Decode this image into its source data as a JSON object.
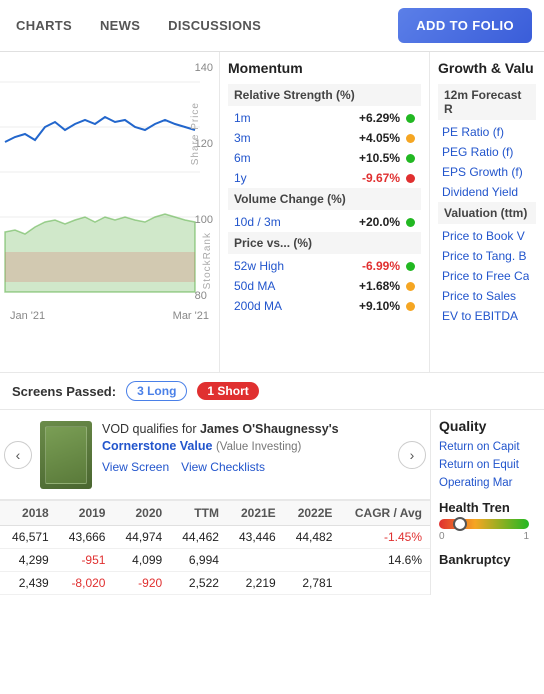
{
  "nav": {
    "items": [
      "CHARTS",
      "NEWS",
      "DISCUSSIONS"
    ],
    "add_to_folio": "ADD TO FOLIO"
  },
  "chart": {
    "y_labels": [
      "140",
      "120",
      "100",
      "80"
    ],
    "x_labels": [
      "Jan '21",
      "Mar '21"
    ],
    "share_price_label": "Share Price",
    "stockrank_label": "StockRank"
  },
  "momentum": {
    "title": "Momentum",
    "relative_strength_title": "Relative Strength (%)",
    "rows": [
      {
        "label": "1m",
        "value": "+6.29%",
        "type": "positive",
        "dot": "green"
      },
      {
        "label": "3m",
        "value": "+4.05%",
        "type": "positive",
        "dot": "orange"
      },
      {
        "label": "6m",
        "value": "+10.5%",
        "type": "positive",
        "dot": "green"
      },
      {
        "label": "1y",
        "value": "-9.67%",
        "type": "negative",
        "dot": "red"
      }
    ],
    "volume_change_title": "Volume Change (%)",
    "volume_rows": [
      {
        "label": "10d / 3m",
        "value": "+20.0%",
        "type": "positive",
        "dot": "green"
      }
    ],
    "price_vs_title": "Price vs... (%)",
    "price_rows": [
      {
        "label": "52w High",
        "value": "-6.99%",
        "type": "negative",
        "dot": "green"
      },
      {
        "label": "50d MA",
        "value": "+1.68%",
        "type": "positive",
        "dot": "orange"
      },
      {
        "label": "200d MA",
        "value": "+9.10%",
        "type": "positive",
        "dot": "orange"
      }
    ]
  },
  "growth": {
    "title": "Growth & Valu",
    "forecast_title": "12m Forecast R",
    "metrics": [
      "PE Ratio (f)",
      "PEG Ratio (f)",
      "EPS Growth (f)",
      "Dividend Yield"
    ],
    "valuation_title": "Valuation (ttm)",
    "valuation_metrics": [
      "Price to Book V",
      "Price to Tang. B",
      "Price to Free Ca",
      "Price to Sales",
      "EV to EBITDA"
    ]
  },
  "screens": {
    "label": "Screens Passed:",
    "long_badge": "3 Long",
    "short_badge": "1 Short"
  },
  "carousel": {
    "card_text_prefix": "VOD qualifies for ",
    "card_strategy": "James O'Shaugnessy's",
    "card_strategy2": "Cornerstone Value",
    "card_strategy_type": "(Value Investing)",
    "view_screen": "View Screen",
    "view_checklists": "View Checklists"
  },
  "table": {
    "headers": [
      "2018",
      "2019",
      "2020",
      "TTM",
      "2021E",
      "2022E",
      "CAGR / Avg"
    ],
    "rows": [
      [
        "46,571",
        "43,666",
        "44,974",
        "44,462",
        "43,446",
        "44,482",
        "-1.45%"
      ],
      [
        "4,299",
        "-951",
        "4,099",
        "6,994",
        "",
        "",
        "14.6%"
      ],
      [
        "2,439",
        "-8,020",
        "-920",
        "2,522",
        "2,219",
        "2,781",
        ""
      ]
    ],
    "negative_cells": [
      [
        1,
        1
      ],
      [
        2,
        1
      ],
      [
        2,
        2
      ]
    ]
  },
  "quality": {
    "title": "Quality",
    "metrics": [
      "Return on Capit",
      "Return on Equit",
      "Operating Mar"
    ],
    "health_trend_title": "Health Tren",
    "health_scale": [
      "0",
      "1"
    ],
    "bankruptcy_title": "Bankruptcy"
  }
}
